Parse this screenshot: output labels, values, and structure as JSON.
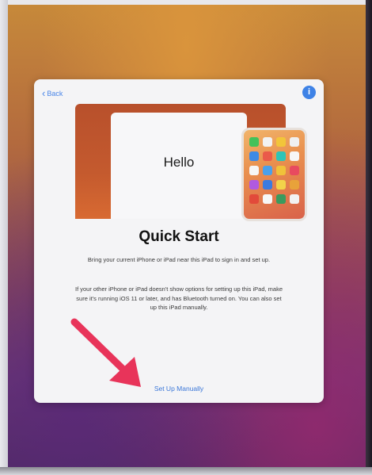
{
  "nav": {
    "back_label": "Back",
    "info_label": "i"
  },
  "hero": {
    "hello_text": "Hello"
  },
  "main": {
    "title": "Quick Start",
    "description_1": "Bring your current iPhone or iPad near this iPad to sign in and set up.",
    "description_2": "If your other iPhone or iPad doesn't show options for setting up this iPad, make sure it's running iOS 11 or later, and has Bluetooth turned on. You can also set up this iPad manually.",
    "manual_link": "Set Up Manually"
  },
  "app_colors": [
    "#43c15a",
    "#f2f2f2",
    "#f2c53a",
    "#f0f0f0",
    "#3e8ae6",
    "#ea5a4a",
    "#2ec4b6",
    "#f7f7f7",
    "#f6f6f6",
    "#4aa0ea",
    "#f0c23a",
    "#e84a5f",
    "#b05ae0",
    "#3a7be0",
    "#f2d24a",
    "#e8a23a",
    "#e24a3a",
    "#f7f7f7",
    "#3a9a5e",
    "#f2f2f2"
  ],
  "colors": {
    "accent": "#3e82e6",
    "arrow": "#e8345a"
  }
}
